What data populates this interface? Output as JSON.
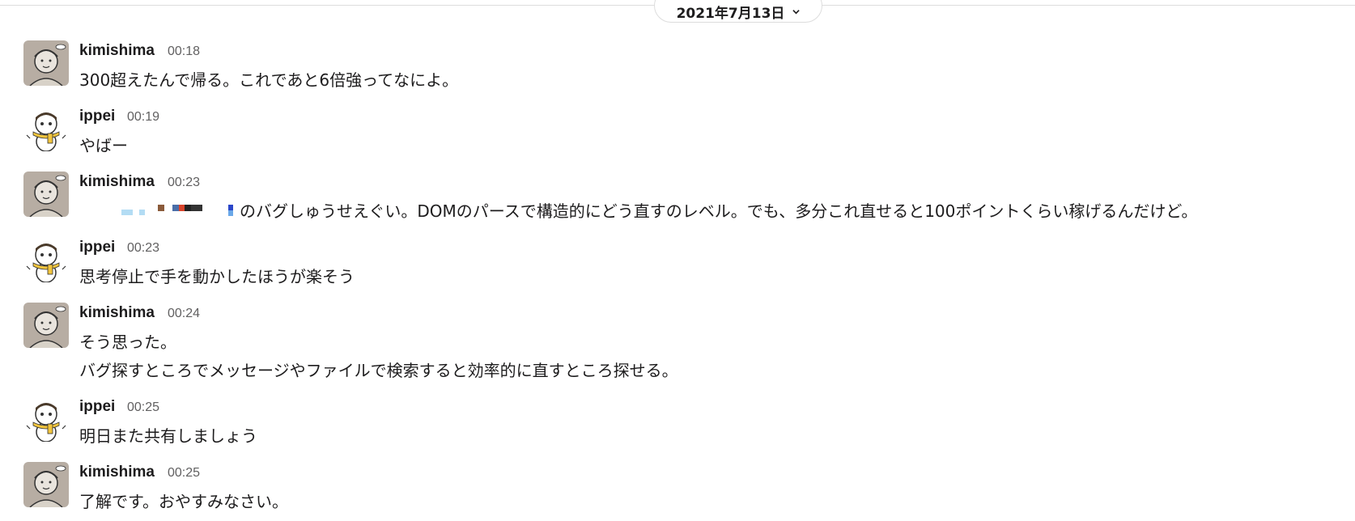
{
  "date_divider": {
    "label": "2021年7月13日"
  },
  "messages": [
    {
      "user": "kimishima",
      "time": "00:18",
      "lines": [
        "300超えたんで帰る。これであと6倍強ってなによ。"
      ]
    },
    {
      "user": "ippei",
      "time": "00:19",
      "lines": [
        "やばー"
      ]
    },
    {
      "user": "kimishima",
      "time": "00:23",
      "lines": [
        "のバグしゅうせえぐい。DOMのパースで構造的にどう直すのレベル。でも、多分これ直せると100ポイントくらい稼げるんだけど。"
      ]
    },
    {
      "user": "ippei",
      "time": "00:23",
      "lines": [
        "思考停止で手を動かしたほうが楽そう"
      ]
    },
    {
      "user": "kimishima",
      "time": "00:24",
      "lines": [
        "そう思った。",
        "バグ探すところでメッセージやファイルで検索すると効率的に直すところ探せる。"
      ]
    },
    {
      "user": "ippei",
      "time": "00:25",
      "lines": [
        "明日また共有しましょう"
      ]
    },
    {
      "user": "kimishima",
      "time": "00:25",
      "lines": [
        "了解です。おやすみなさい。"
      ]
    }
  ],
  "colors": {
    "avatar_kimishima_bg": "#b7ada3",
    "avatar_ippei_scarf": "#f2c53d"
  },
  "icons": {
    "avatar_kimishima": "sketch-face-avatar",
    "avatar_ippei": "snowman-avatar",
    "chevron": "chevron-down-icon"
  }
}
